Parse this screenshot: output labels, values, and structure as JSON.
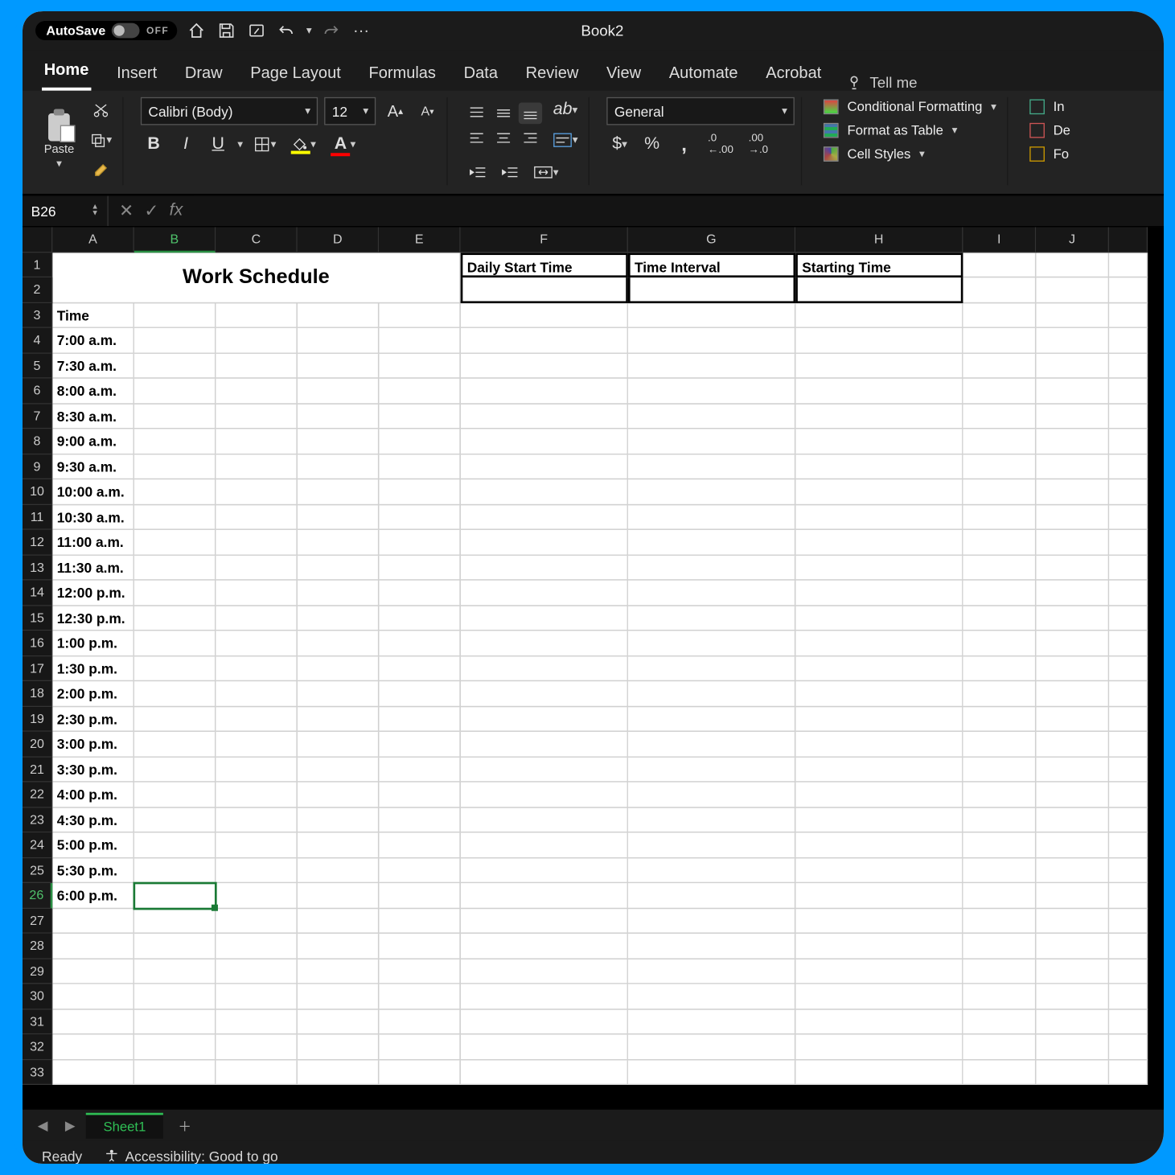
{
  "titlebar": {
    "autosave_label": "AutoSave",
    "autosave_state": "OFF",
    "doc_title": "Book2",
    "more": "···"
  },
  "tabs": {
    "items": [
      "Home",
      "Insert",
      "Draw",
      "Page Layout",
      "Formulas",
      "Data",
      "Review",
      "View",
      "Automate",
      "Acrobat"
    ],
    "active": "Home",
    "tellme": "Tell me"
  },
  "ribbon": {
    "paste": "Paste",
    "font_name": "Calibri (Body)",
    "font_size": "12",
    "number_format": "General",
    "cond_fmt": "Conditional Formatting",
    "table_fmt": "Format as Table",
    "cell_styles": "Cell Styles",
    "insert_col": "In",
    "delete_col": "De",
    "format_col": "Fo"
  },
  "fx": {
    "namebox": "B26",
    "formula": ""
  },
  "grid": {
    "columns": [
      "A",
      "B",
      "C",
      "D",
      "E",
      "F",
      "G",
      "H",
      "I",
      "J"
    ],
    "row_count": 33,
    "selected_cell": "B26",
    "title": "Work Schedule",
    "headers_row1": {
      "F": "Daily Start Time",
      "G": "Time Interval",
      "H": "Starting Time"
    },
    "a3": "Time",
    "times": [
      "7:00 a.m.",
      "7:30 a.m.",
      "8:00 a.m.",
      "8:30 a.m.",
      "9:00 a.m.",
      "9:30 a.m.",
      "10:00 a.m.",
      "10:30 a.m.",
      "11:00 a.m.",
      "11:30 a.m.",
      "12:00 p.m.",
      "12:30 p.m.",
      "1:00 p.m.",
      "1:30 p.m.",
      "2:00 p.m.",
      "2:30 p.m.",
      "3:00 p.m.",
      "3:30 p.m.",
      "4:00 p.m.",
      "4:30 p.m.",
      "5:00 p.m.",
      "5:30 p.m.",
      "6:00 p.m."
    ]
  },
  "sheet_tabs": {
    "active": "Sheet1"
  },
  "status": {
    "ready": "Ready",
    "accessibility": "Accessibility: Good to go"
  }
}
